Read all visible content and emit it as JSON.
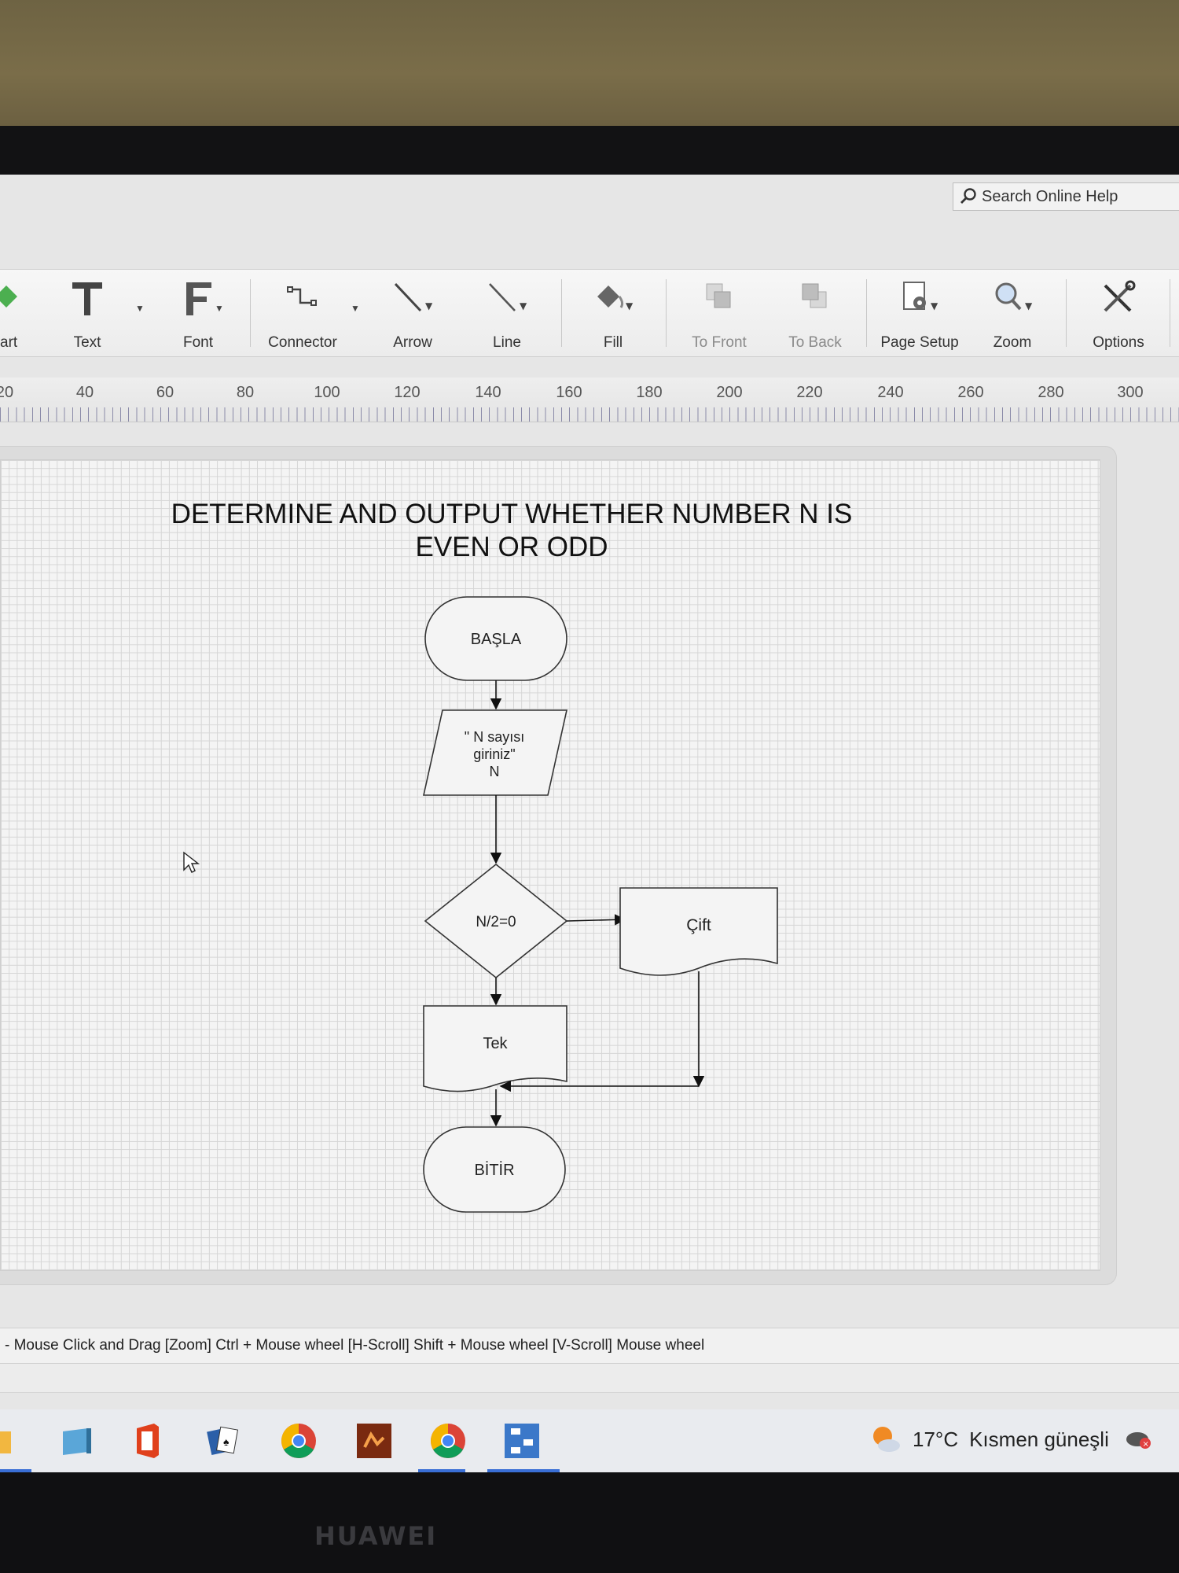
{
  "window": {
    "search_label": "Search Online Help"
  },
  "ribbon": {
    "tools": [
      {
        "id": "chart",
        "label": "art",
        "icon": "chart-icon"
      },
      {
        "id": "text",
        "label": "Text",
        "icon": "text-icon"
      },
      {
        "id": "font",
        "label": "Font",
        "icon": "font-icon"
      },
      {
        "id": "connector",
        "label": "Connector",
        "icon": "connector-icon"
      },
      {
        "id": "arrow",
        "label": "Arrow",
        "icon": "arrow-icon"
      },
      {
        "id": "line",
        "label": "Line",
        "icon": "line-icon"
      },
      {
        "id": "fill",
        "label": "Fill",
        "icon": "fill-bucket-icon"
      },
      {
        "id": "to_front",
        "label": "To Front",
        "icon": "bring-to-front-icon"
      },
      {
        "id": "to_back",
        "label": "To Back",
        "icon": "send-to-back-icon"
      },
      {
        "id": "page_setup",
        "label": "Page Setup",
        "icon": "page-setup-icon"
      },
      {
        "id": "zoom",
        "label": "Zoom",
        "icon": "zoom-icon"
      },
      {
        "id": "options",
        "label": "Options",
        "icon": "options-tools-icon"
      }
    ]
  },
  "ruler": {
    "labels": [
      "20",
      "40",
      "60",
      "80",
      "100",
      "120",
      "140",
      "160",
      "180",
      "200",
      "220",
      "240",
      "260",
      "280",
      "300"
    ]
  },
  "diagram": {
    "title_line1": "DETERMINE AND OUTPUT WHETHER NUMBER N IS",
    "title_line2": "EVEN OR ODD",
    "start": "BAŞLA",
    "input_line1": "\" N sayısı",
    "input_line2": "giriniz\"",
    "input_line3": "N",
    "decision": "N/2=0",
    "output_even": "Çift",
    "output_odd": "Tek",
    "end": "BİTİR"
  },
  "status": {
    "hint": "- Mouse Click and Drag  [Zoom] Ctrl + Mouse wheel  [H-Scroll] Shift + Mouse wheel  [V-Scroll] Mouse wheel"
  },
  "taskbar": {
    "weather_temp": "17°C",
    "weather_desc": "Kısmen güneşli"
  },
  "device": {
    "brand": "HUAWEI"
  }
}
